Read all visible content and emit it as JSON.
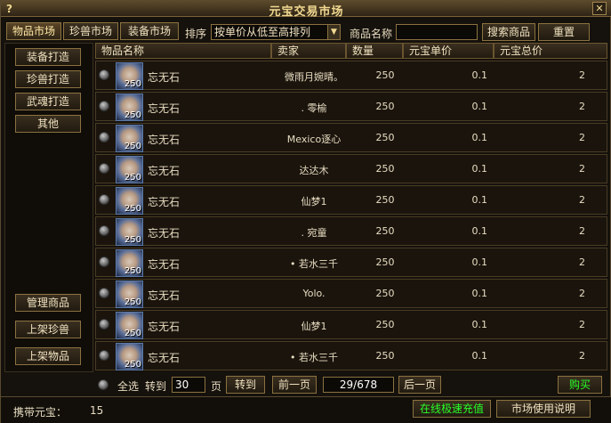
{
  "window": {
    "title": "元宝交易市场",
    "help": "?",
    "close": "✕"
  },
  "tabs": [
    {
      "label": "物品市场",
      "active": true
    },
    {
      "label": "珍兽市场",
      "active": false
    },
    {
      "label": "装备市场",
      "active": false
    }
  ],
  "sort": {
    "label": "排序",
    "selected": "按单价从低至高排列"
  },
  "search": {
    "label": "商品名称",
    "value": "",
    "search_button": "搜索商品",
    "reset_button": "重置"
  },
  "left_menu": {
    "top": [
      "装备打造",
      "珍兽打造",
      "武魂打造",
      "其他"
    ],
    "bottom": [
      "管理商品",
      "上架珍兽",
      "上架物品"
    ]
  },
  "table": {
    "headers": [
      "物品名称",
      "卖家",
      "数量",
      "元宝单价",
      "元宝总价"
    ],
    "rows": [
      {
        "name": "忘无石",
        "seller": "微雨月婉晴。",
        "qty": "250",
        "unit": "0.1",
        "total": "2",
        "icon_qty": "250"
      },
      {
        "name": "忘无石",
        "seller": ". 零榆",
        "qty": "250",
        "unit": "0.1",
        "total": "2",
        "icon_qty": "250"
      },
      {
        "name": "忘无石",
        "seller": "Mexico逐心",
        "qty": "250",
        "unit": "0.1",
        "total": "2",
        "icon_qty": "250"
      },
      {
        "name": "忘无石",
        "seller": "达达木",
        "qty": "250",
        "unit": "0.1",
        "total": "2",
        "icon_qty": "250"
      },
      {
        "name": "忘无石",
        "seller": "仙梦1",
        "qty": "250",
        "unit": "0.1",
        "total": "2",
        "icon_qty": "250"
      },
      {
        "name": "忘无石",
        "seller": ". 宛童",
        "qty": "250",
        "unit": "0.1",
        "total": "2",
        "icon_qty": "250"
      },
      {
        "name": "忘无石",
        "seller": "• 若水三千",
        "qty": "250",
        "unit": "0.1",
        "total": "2",
        "icon_qty": "250"
      },
      {
        "name": "忘无石",
        "seller": "Yolo.",
        "qty": "250",
        "unit": "0.1",
        "total": "2",
        "icon_qty": "250"
      },
      {
        "name": "忘无石",
        "seller": "仙梦1",
        "qty": "250",
        "unit": "0.1",
        "total": "2",
        "icon_qty": "250"
      },
      {
        "name": "忘无石",
        "seller": "• 若水三千",
        "qty": "250",
        "unit": "0.1",
        "total": "2",
        "icon_qty": "250"
      }
    ]
  },
  "pager": {
    "select_all": "全选",
    "goto_label": "转到",
    "page_input": "30",
    "page_unit": "页",
    "goto_button": "转到",
    "prev": "前一页",
    "page_display": "29/678",
    "next": "后一页",
    "buy": "购买"
  },
  "footer": {
    "yuanbao_label": "携带元宝：",
    "yuanbao_value": "15",
    "recharge": "在线极速充值",
    "help": "市场使用说明"
  }
}
